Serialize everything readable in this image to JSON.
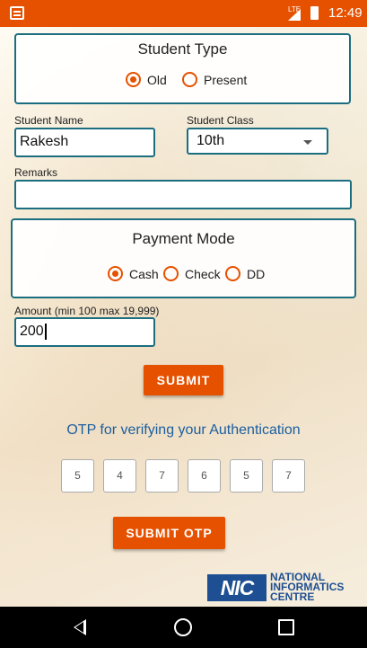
{
  "status_bar": {
    "network": "LTE",
    "time": "12:49"
  },
  "student_type": {
    "title": "Student Type",
    "options": [
      "Old",
      "Present"
    ],
    "selected": "Old"
  },
  "student_name": {
    "label": "Student Name",
    "value": "Rakesh"
  },
  "student_class": {
    "label": "Student Class",
    "value": "10th"
  },
  "remarks": {
    "label": "Remarks",
    "value": ""
  },
  "payment_mode": {
    "title": "Payment Mode",
    "options": [
      "Cash",
      "Check",
      "DD"
    ],
    "selected": "Cash"
  },
  "amount": {
    "label": "Amount (min 100 max 19,999)",
    "value": "200"
  },
  "submit_label": "SUBMIT",
  "otp": {
    "title": "OTP for verifying your Authentication",
    "digits": [
      "5",
      "4",
      "7",
      "6",
      "5",
      "7"
    ]
  },
  "submit_otp_label": "SUBMIT OTP",
  "logo": {
    "mark": "NIC",
    "line1": "NATIONAL",
    "line2": "INFORMATICS",
    "line3": "CENTRE"
  },
  "colors": {
    "accent": "#e65100",
    "border": "#1b6e80",
    "otp_text": "#1b5fa0"
  }
}
